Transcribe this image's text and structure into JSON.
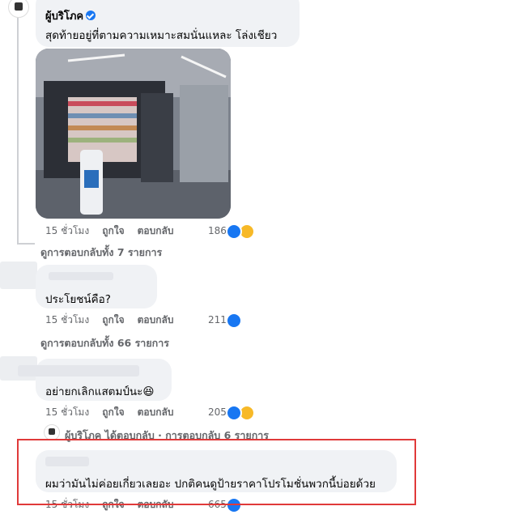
{
  "comments": [
    {
      "author": "ผู้บริโภค",
      "text": "สุดท้ายอยู่ที่ตามความเหมาะสมนั่นแหละ โล่งเชียว",
      "time": "15 ชั่วโมง",
      "like_label": "ถูกใจ",
      "reply_label": "ตอบกลับ",
      "reaction_count": "186",
      "reactions": [
        "like",
        "haha"
      ],
      "view_replies": "ดูการตอบกลับทั้ง 7 รายการ"
    },
    {
      "text": "ประโยชน์คือ?",
      "time": "15 ชั่วโมง",
      "like_label": "ถูกใจ",
      "reply_label": "ตอบกลับ",
      "reaction_count": "211",
      "reactions": [
        "like"
      ],
      "view_replies": "ดูการตอบกลับทั้ง 66 รายการ"
    },
    {
      "text": "อย่ายกเลิกแสตมป์นะ😆",
      "time": "15 ชั่วโมง",
      "like_label": "ถูกใจ",
      "reply_label": "ตอบกลับ",
      "reaction_count": "205",
      "reactions": [
        "like",
        "haha"
      ],
      "reply_summary": "ผู้บริโภค ได้ตอบกลับ · การตอบกลับ 6 รายการ"
    },
    {
      "text": "ผมว่ามันไม่ค่อยเกี่ยวเลยอะ ปกติคนดูป้ายราคาโปรโมชั่นพวกนี้บ่อยด้วย",
      "time": "15 ชั่วโมง",
      "like_label": "ถูกใจ",
      "reply_label": "ตอบกลับ",
      "reaction_count": "665",
      "reactions": [
        "like"
      ]
    }
  ],
  "colors": {
    "bubble": "#f0f2f5",
    "meta_text": "#65676b",
    "like_blue": "#1877f2",
    "highlight_red": "#e03a3a"
  }
}
